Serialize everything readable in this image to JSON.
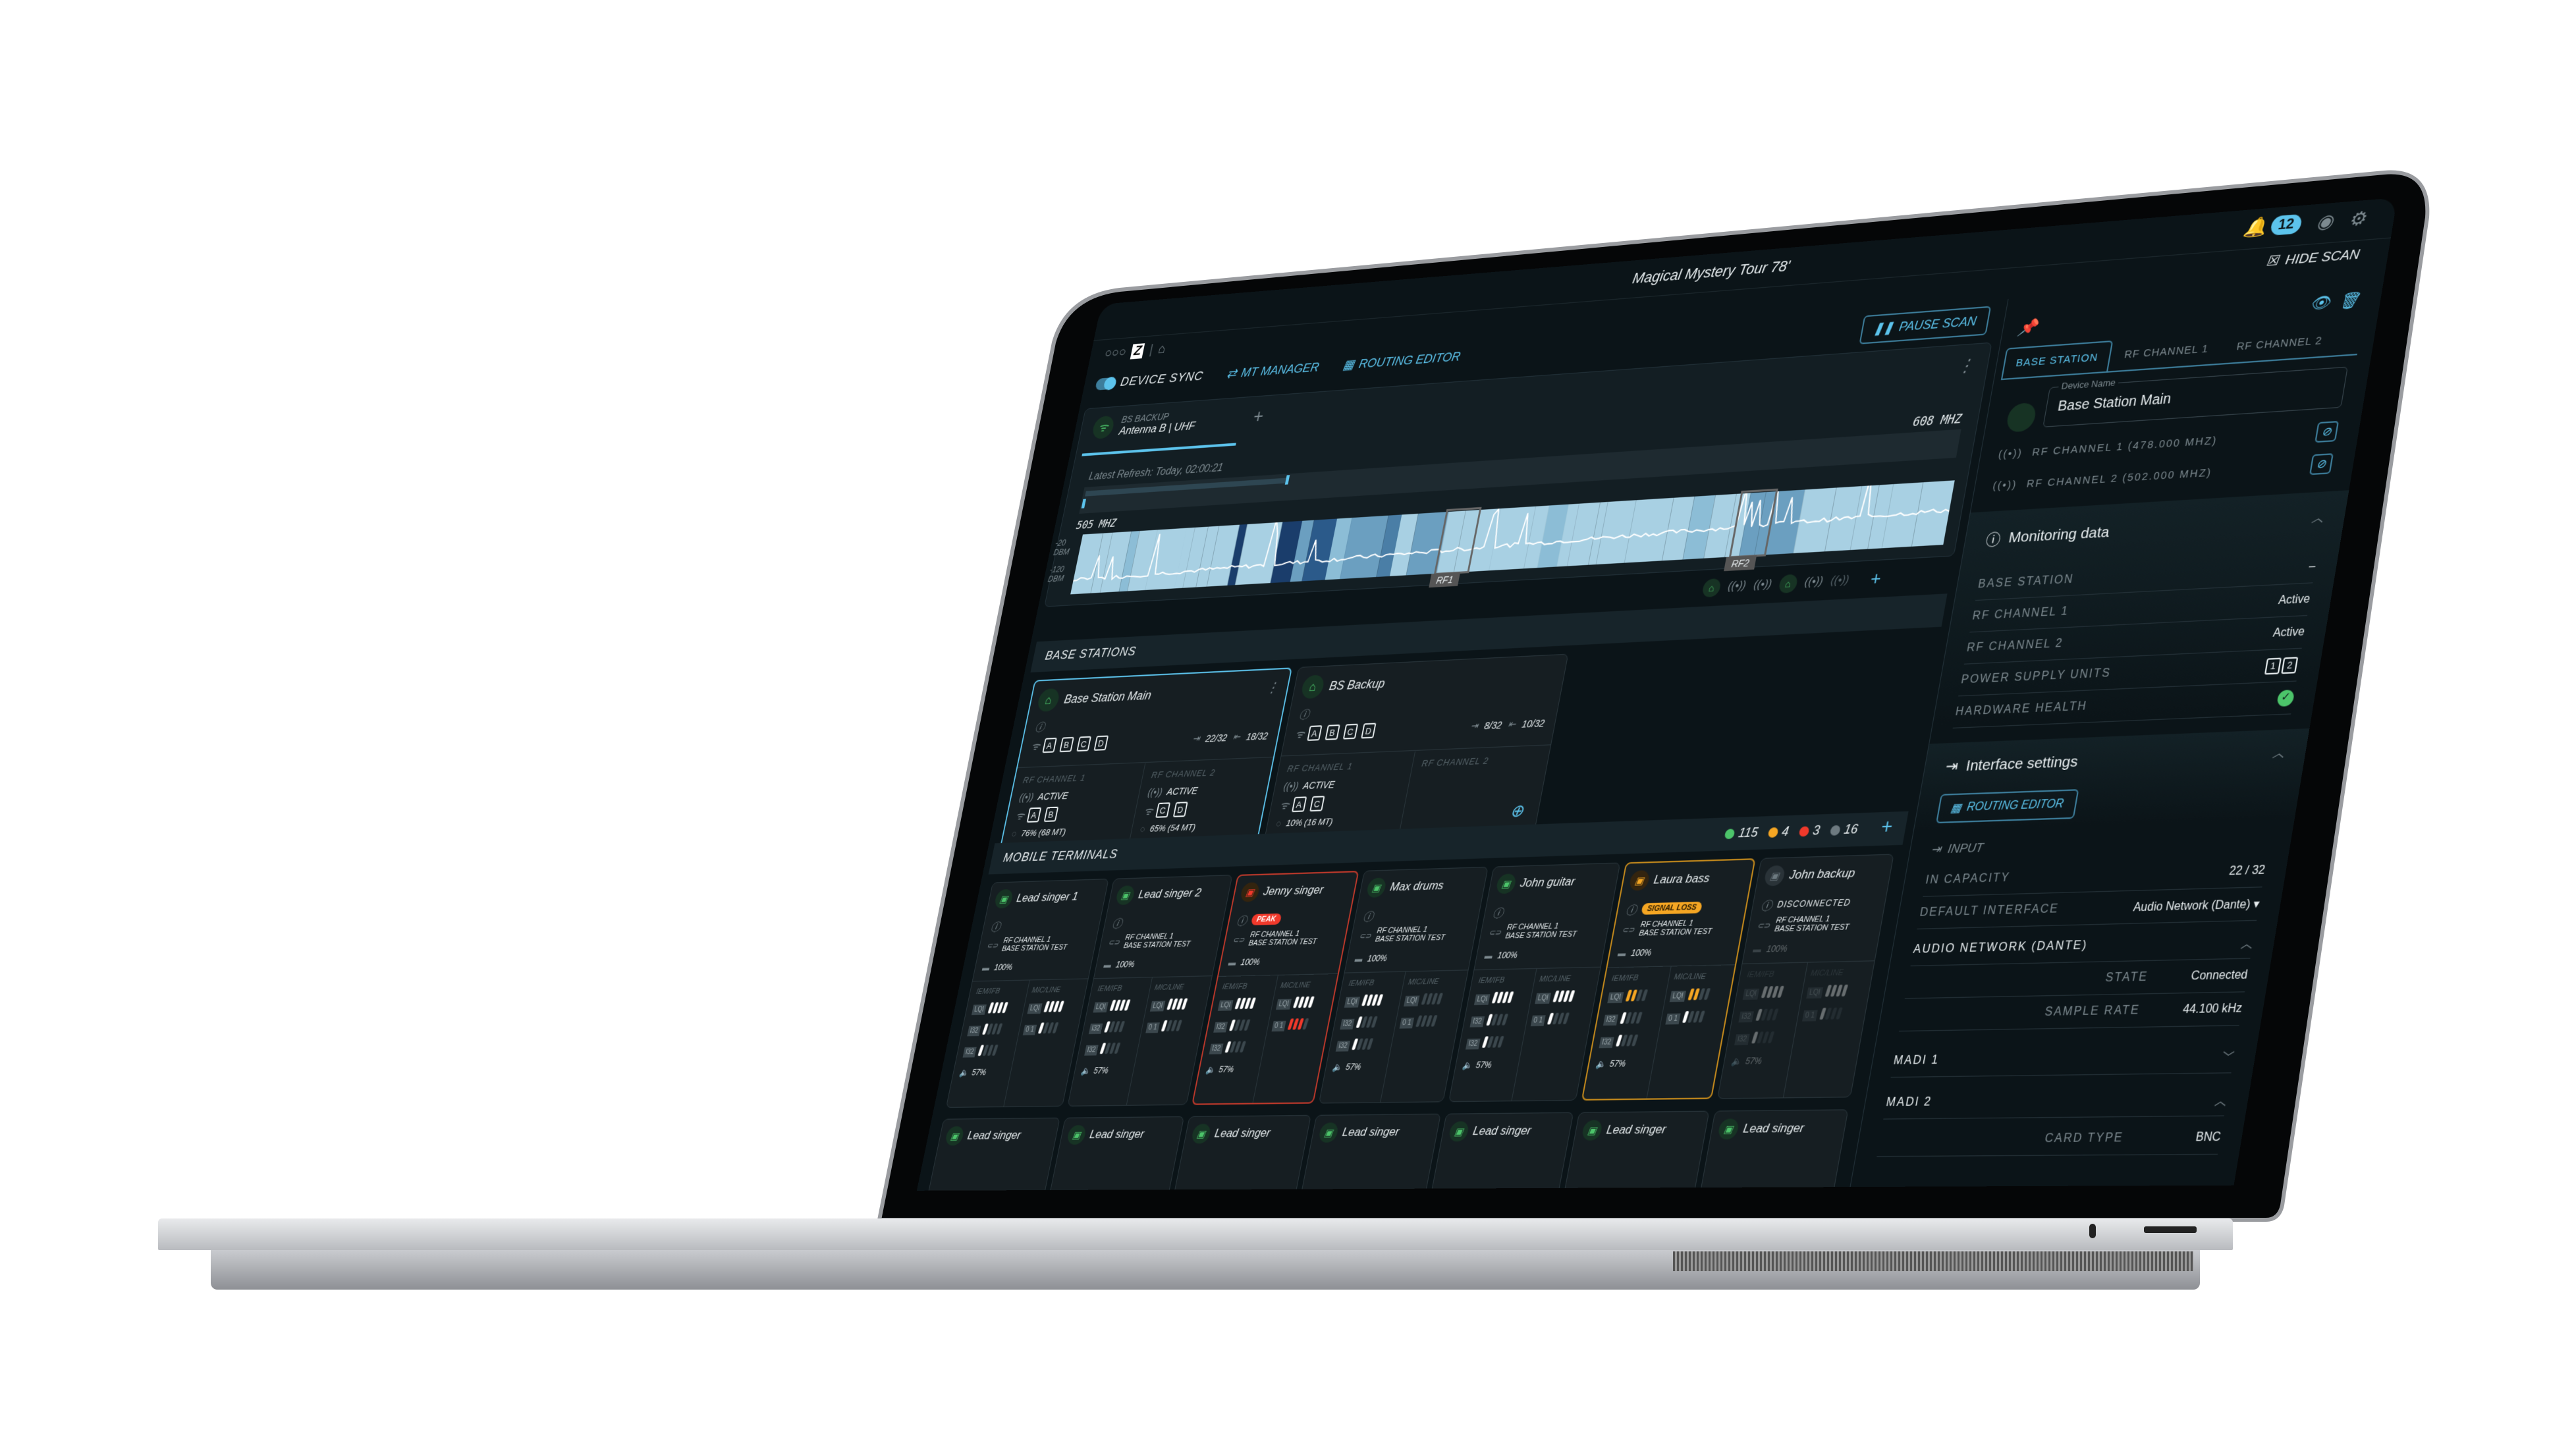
{
  "window": {
    "title": "Magical Mystery Tour 78'",
    "notification_count": "12"
  },
  "toolbar": {
    "device_sync": "DEVICE SYNC",
    "device_sync_on": true,
    "mt_manager": "MT MANAGER",
    "routing_editor": "ROUTING EDITOR",
    "hide_scan": "HIDE SCAN",
    "pause_scan": "PAUSE SCAN"
  },
  "scan": {
    "tab_label": "BS BACKUP",
    "tab_sub": "Antenna B | UHF",
    "latest_refresh": "Latest Refresh: Today, 02:00:21",
    "freq_start": "505 MHZ",
    "freq_end": "608 MHZ",
    "db_top": "-20 DBM",
    "db_bottom": "-120 DBM",
    "markers": [
      "RF1",
      "RF2"
    ]
  },
  "base_stations": {
    "title": "BASE STATIONS",
    "cards": [
      {
        "name": "Base Station Main",
        "antennas": [
          "A",
          "B",
          "C",
          "D"
        ],
        "in": "22/32",
        "out": "18/32",
        "ch1": {
          "label": "RF CHANNEL 1",
          "status": "ACTIVE",
          "antennas": [
            "A",
            "B"
          ],
          "load": "76% (68 MT)"
        },
        "ch2": {
          "label": "RF CHANNEL 2",
          "status": "ACTIVE",
          "antennas": [
            "C",
            "D"
          ],
          "load": "65% (54 MT)"
        }
      },
      {
        "name": "BS Backup",
        "antennas": [
          "A",
          "B",
          "C",
          "D"
        ],
        "in": "8/32",
        "out": "10/32",
        "ch1": {
          "label": "RF CHANNEL 1",
          "status": "ACTIVE",
          "antennas": [
            "A",
            "C"
          ],
          "load": "10% (16 MT)"
        },
        "ch2": {
          "label": "RF CHANNEL 2",
          "status": "",
          "antennas": [],
          "load": ""
        }
      }
    ]
  },
  "mobile_terminals": {
    "title": "MOBILE TERMINALS",
    "counts": {
      "ok": "115",
      "warning": "4",
      "error": "3",
      "offline": "16"
    },
    "colors": {
      "ok": "#4cc46a",
      "warning": "#f5a623",
      "error": "#f0392b",
      "offline": "#6d7a80"
    },
    "col_a": "IEM/IFB",
    "col_b": "MIC/LINE",
    "link1": "RF CHANNEL 1",
    "link2": "BASE STATION TEST",
    "cards": [
      {
        "name": "Lead singer 1",
        "state": "ok",
        "badge": "",
        "battery": "100%",
        "volume": "57%"
      },
      {
        "name": "Lead singer 2",
        "state": "ok",
        "badge": "",
        "battery": "100%",
        "volume": "57%"
      },
      {
        "name": "Jenny singer",
        "state": "error",
        "badge": "PEAK",
        "battery": "100%",
        "volume": "57%"
      },
      {
        "name": "Max drums",
        "state": "ok",
        "badge": "",
        "battery": "100%",
        "volume": "57%"
      },
      {
        "name": "John guitar",
        "state": "ok",
        "badge": "",
        "battery": "100%",
        "volume": "57%"
      },
      {
        "name": "Laura bass",
        "state": "warning",
        "badge": "SIGNAL LOSS",
        "battery": "100%",
        "volume": "57%"
      },
      {
        "name": "John backup",
        "state": "offline",
        "badge": "DISCONNECTED",
        "battery": "100%",
        "volume": "57%"
      }
    ],
    "next_row": [
      "Lead singer",
      "Lead singer",
      "Lead singer",
      "Lead singer",
      "Lead singer",
      "Lead singer",
      "Lead singer"
    ]
  },
  "right_panel": {
    "tabs": [
      "BASE STATION",
      "RF CHANNEL 1",
      "RF CHANNEL 2"
    ],
    "device_name_label": "Device Name",
    "device_name": "Base Station Main",
    "rf1": "RF CHANNEL 1 (478.000 MHZ)",
    "rf2": "RF CHANNEL 2 (502.000 MHZ)",
    "monitoring": {
      "title": "Monitoring data",
      "rows": [
        {
          "k": "BASE STATION",
          "v": "–"
        },
        {
          "k": "RF CHANNEL 1",
          "v": "Active"
        },
        {
          "k": "RF CHANNEL 2",
          "v": "Active"
        },
        {
          "k": "POWER SUPPLY UNITS",
          "v": ""
        },
        {
          "k": "HARDWARE HEALTH",
          "v": ""
        }
      ],
      "psu": [
        "1",
        "2"
      ]
    },
    "interface": {
      "title": "Interface settings",
      "routing_editor": "ROUTING EDITOR",
      "input": "INPUT",
      "in_capacity_k": "IN CAPACITY",
      "in_capacity_v": "22 / 32",
      "default_interface_k": "DEFAULT INTERFACE",
      "default_interface_v": "Audio Network (Dante)",
      "dante": "AUDIO NETWORK (DANTE)",
      "state_k": "STATE",
      "state_v": "Connected",
      "rate_k": "SAMPLE RATE",
      "rate_v": "44.100 kHz",
      "madi1": "MADI 1",
      "madi2": "MADI 2",
      "card_type_k": "CARD TYPE",
      "card_type_v": "BNC"
    }
  }
}
